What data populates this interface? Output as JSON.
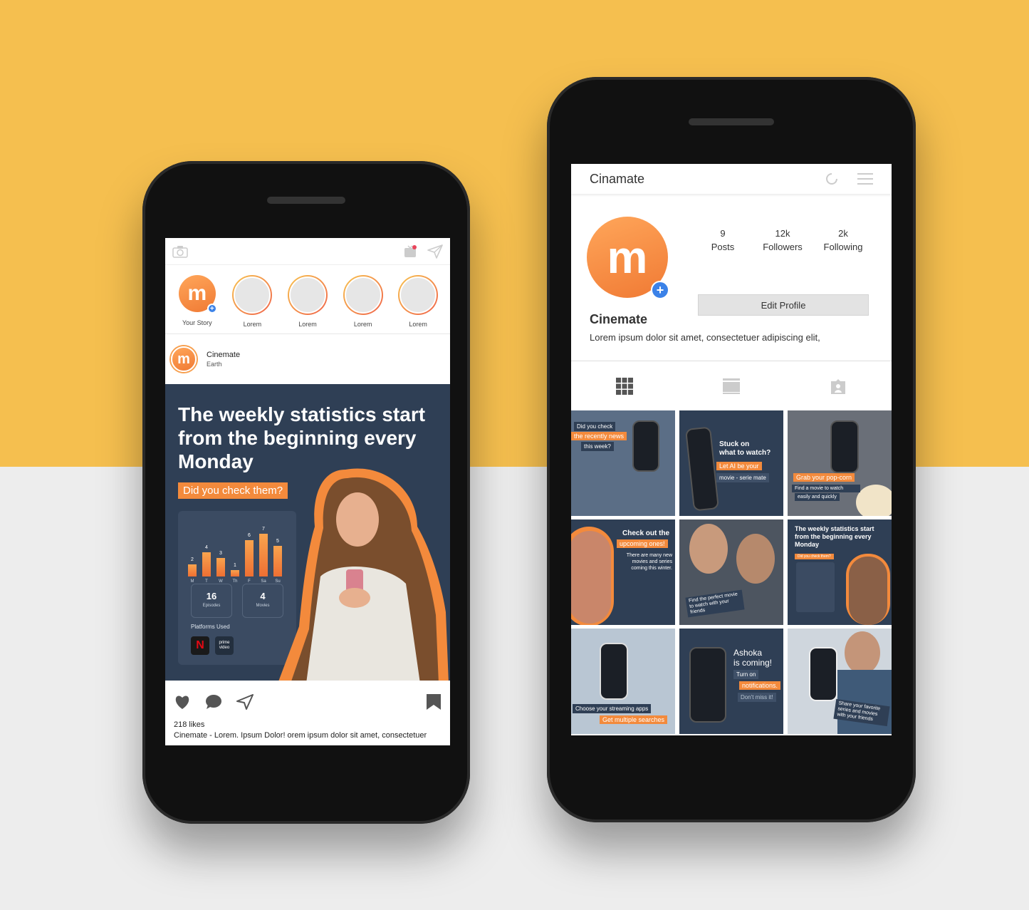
{
  "feed": {
    "stories": [
      {
        "label": "Your Story"
      },
      {
        "label": "Lorem"
      },
      {
        "label": "Lorem"
      },
      {
        "label": "Lorem"
      },
      {
        "label": "Lorem"
      }
    ],
    "post": {
      "account_name": "Cinemate",
      "location": "Earth",
      "headline": "The weekly statistics start from the beginning every Monday",
      "cta": "Did you check them?",
      "chart_data": {
        "type": "bar",
        "categories": [
          "M",
          "T",
          "W",
          "Th",
          "F",
          "Sa",
          "Su"
        ],
        "values": [
          2,
          4,
          3,
          1,
          6,
          7,
          5
        ]
      },
      "episodes": {
        "value": "16",
        "label": "Episodes"
      },
      "movies": {
        "value": "4",
        "label": "Movies"
      },
      "platforms_label": "Platforms Used",
      "platform_netflix": "N",
      "platform_prime": "prime video",
      "likes": "218 likes",
      "caption": "Cinemate - Lorem. Ipsum Dolor! orem ipsum dolor sit amet, consectetuer"
    }
  },
  "profile": {
    "app_title": "Cinamate",
    "stats": [
      {
        "value": "9",
        "label": "Posts"
      },
      {
        "value": "12k",
        "label": "Followers"
      },
      {
        "value": "2k",
        "label": "Following"
      }
    ],
    "edit_button": "Edit Profile",
    "name": "Cinemate",
    "bio": "Lorem ipsum dolor sit amet, consectetuer adipiscing elit,",
    "tiles": {
      "t1": {
        "line1": "Did you check",
        "line2": "the recently news",
        "line3": "this week?"
      },
      "t2": {
        "line1": "Stuck on",
        "line2": "what to watch?",
        "line3": "Let AI be your",
        "line4": "movie - serie mate"
      },
      "t3": {
        "line1": "Grab your pop-corn",
        "line2": "Find a movie to watch",
        "line3": "easily and quickly"
      },
      "t4": {
        "line1": "Check out the",
        "line2": "upcoming ones!",
        "line3": "There are many new movies and series coming this winter."
      },
      "t5": {
        "line1": "Find the perfect movie to watch with your friends"
      },
      "t6": {
        "line1": "The weekly statistics start from the beginning every Monday",
        "line2": "Did you check them?"
      },
      "t7": {
        "line1": "Choose your streaming apps",
        "line2": "Get multiple searches"
      },
      "t8": {
        "line1": "Ashoka",
        "line2": "is coming!",
        "line3": "Turn on",
        "line4": "notifications.",
        "line5": "Don't miss it!"
      },
      "t9": {
        "line1": "Share your favorite series and movies with your friends"
      }
    }
  },
  "colors": {
    "accent": "#f38a3c",
    "navy": "#2f3f55",
    "blue_badge": "#3b82e8",
    "background_top": "#f5bf4f"
  }
}
